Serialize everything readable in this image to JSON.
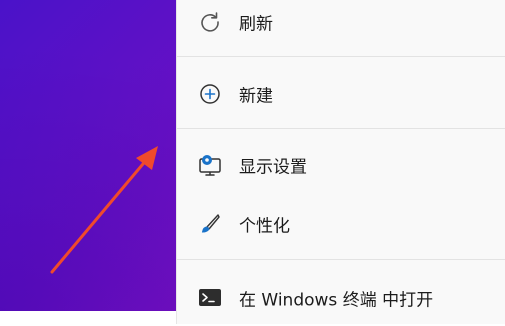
{
  "context_menu": {
    "items": [
      {
        "label": "刷新",
        "icon": "refresh-icon"
      },
      {
        "label": "新建",
        "icon": "add-circle-icon"
      },
      {
        "label": "显示设置",
        "icon": "display-settings-icon"
      },
      {
        "label": "个性化",
        "icon": "brush-icon"
      },
      {
        "label": "在 Windows 终端 中打开",
        "icon": "terminal-icon"
      }
    ]
  },
  "colors": {
    "menu_background": "#f9f9f9",
    "desktop_gradient_start": "#4a12c9",
    "desktop_gradient_end": "#9a1ac8",
    "arrow": "#f04a2c",
    "icon_accent": "#1a73c9"
  }
}
